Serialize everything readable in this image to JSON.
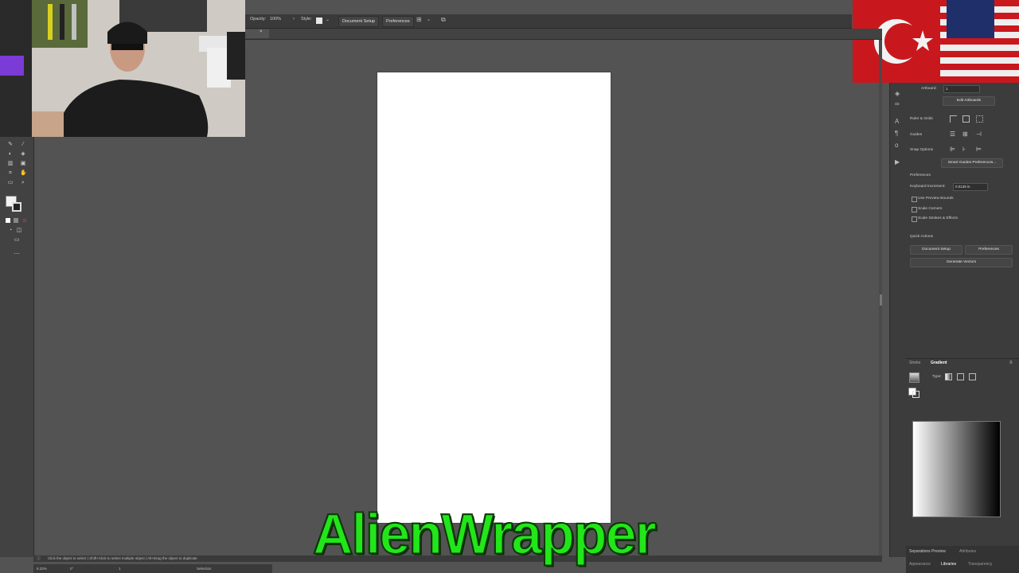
{
  "control_bar": {
    "opacity_label": "Opacity:",
    "opacity_value": "100%",
    "style_label": "Style:",
    "document_setup": "Document Setup",
    "preferences": "Preferences"
  },
  "document_tab": {
    "close": "×"
  },
  "properties": {
    "artboard_label": "Artboard:",
    "artboard_value": "1",
    "edit_artboards": "Edit Artboards",
    "ruler_grids": "Ruler & Grids",
    "guides": "Guides",
    "snap_options": "Snap Options",
    "smart_guides_prefs": "Smart Guides Preferences...",
    "preferences_heading": "Preferences",
    "keyboard_increment_label": "Keyboard Increment:",
    "keyboard_increment_value": "0.0139 in",
    "use_preview_bounds": "Use Preview Bounds",
    "scale_corners": "Scale Corners",
    "scale_strokes_effects": "Scale Strokes & Effects",
    "quick_actions": "Quick Actions",
    "document_setup_btn": "Document Setup",
    "preferences_btn": "Preferences",
    "generate_vectors": "Generate Vectors"
  },
  "gradient_panel": {
    "tab_stroke": "Stroke",
    "tab_gradient": "Gradient",
    "type_label": "Type:"
  },
  "bottom_tabs": {
    "separations_preview": "Separations Preview",
    "attributes": "Attributes",
    "appearance": "Appearance",
    "libraries": "Libraries",
    "transparency": "Transparency"
  },
  "status": {
    "hint": "Click the object to select  |  Shift+Click to select multiple object  |  Alt+Drag the object to duplicate",
    "zoom": "8.33%",
    "rotation": "0°",
    "artboard_num": "1",
    "tool": "Selection"
  },
  "overlay": {
    "watermark": "AlienWrapper"
  },
  "colors": {
    "accent_green": "#22e61a",
    "ui_dark": "#3c3c3c",
    "canvas_gray": "#535353"
  }
}
